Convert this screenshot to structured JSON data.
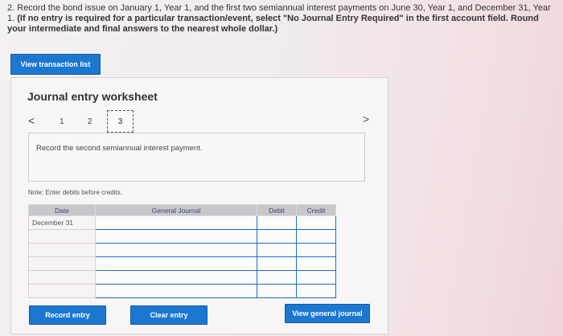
{
  "question": {
    "number": "2.",
    "text": "Record the bond issue on January 1, Year 1, and the first two semiannual interest payments on June 30, Year 1, and December 31, Year 1.",
    "bold": "(If no entry is required for a particular transaction/event, select \"No Journal Entry Required\" in the first account field. Round your intermediate and final answers to the nearest whole dollar.)"
  },
  "view_transaction_list": "View transaction list",
  "worksheet": {
    "title": "Journal entry worksheet",
    "prev": "<",
    "next": ">",
    "pages": [
      "1",
      "2",
      "3"
    ],
    "description": "Record the second semiannual interest payment.",
    "note": "Note: Enter debits before credits."
  },
  "table": {
    "headers": [
      "Date",
      "General Journal",
      "Debit",
      "Credit"
    ],
    "rows": [
      {
        "date": "December 31"
      },
      {
        "date": ""
      },
      {
        "date": ""
      },
      {
        "date": ""
      },
      {
        "date": ""
      },
      {
        "date": ""
      }
    ]
  },
  "buttons": {
    "record": "Record entry",
    "clear": "Clear entry",
    "view_journal": "View general journal"
  }
}
